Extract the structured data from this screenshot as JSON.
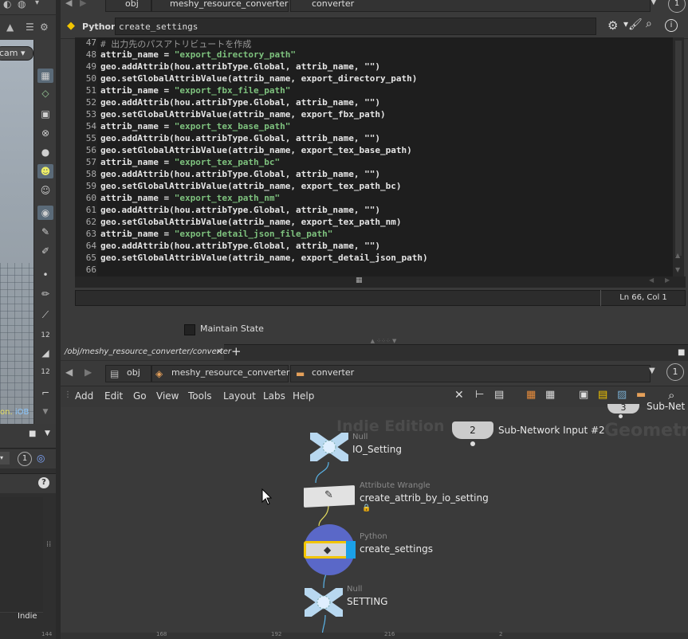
{
  "node": {
    "type_label": "Python",
    "name": "create_settings"
  },
  "editor": {
    "lines": [
      {
        "n": "47",
        "comment": "# 出力先のパスアトリビュートを作成"
      },
      {
        "n": "48",
        "pre": "attrib_name = ",
        "str": "\"export_directory_path\"",
        "post": ""
      },
      {
        "n": "49",
        "pre": "geo.addAttrib(hou.attribType.Global, attrib_name, \"\")",
        "str": "",
        "post": ""
      },
      {
        "n": "50",
        "pre": "geo.setGlobalAttribValue(attrib_name, export_directory_path)",
        "str": "",
        "post": ""
      },
      {
        "n": "51",
        "pre": "attrib_name = ",
        "str": "\"export_fbx_file_path\"",
        "post": ""
      },
      {
        "n": "52",
        "pre": "geo.addAttrib(hou.attribType.Global, attrib_name, \"\")",
        "str": "",
        "post": ""
      },
      {
        "n": "53",
        "pre": "geo.setGlobalAttribValue(attrib_name, export_fbx_path)",
        "str": "",
        "post": ""
      },
      {
        "n": "54",
        "pre": "attrib_name = ",
        "str": "\"export_tex_base_path\"",
        "post": ""
      },
      {
        "n": "55",
        "pre": "geo.addAttrib(hou.attribType.Global, attrib_name, \"\")",
        "str": "",
        "post": ""
      },
      {
        "n": "56",
        "pre": "geo.setGlobalAttribValue(attrib_name, export_tex_base_path)",
        "str": "",
        "post": ""
      },
      {
        "n": "57",
        "pre": "attrib_name = ",
        "str": "\"export_tex_path_bc\"",
        "post": ""
      },
      {
        "n": "58",
        "pre": "geo.addAttrib(hou.attribType.Global, attrib_name, \"\")",
        "str": "",
        "post": ""
      },
      {
        "n": "59",
        "pre": "geo.setGlobalAttribValue(attrib_name, export_tex_path_bc)",
        "str": "",
        "post": ""
      },
      {
        "n": "60",
        "pre": "attrib_name = ",
        "str": "\"export_tex_path_nm\"",
        "post": ""
      },
      {
        "n": "61",
        "pre": "geo.addAttrib(hou.attribType.Global, attrib_name, \"\")",
        "str": "",
        "post": ""
      },
      {
        "n": "62",
        "pre": "geo.setGlobalAttribValue(attrib_name, export_tex_path_nm)",
        "str": "",
        "post": ""
      },
      {
        "n": "63",
        "pre": "attrib_name = ",
        "str": "\"export_detail_json_file_path\"",
        "post": ""
      },
      {
        "n": "64",
        "pre": "geo.addAttrib(hou.attribType.Global, attrib_name, \"\")",
        "str": "",
        "post": ""
      },
      {
        "n": "65",
        "pre": "geo.setGlobalAttribValue(attrib_name, export_detail_json_path)",
        "str": "",
        "post": ""
      },
      {
        "n": "66",
        "pre": "",
        "str": "",
        "post": ""
      }
    ],
    "cursor_pos": "Ln 66, Col 1"
  },
  "maintain_state": "Maintain State",
  "viewport": {
    "cam_label": "cam",
    "footer_text": "on. ",
    "footer_link": "iOB"
  },
  "left_panel": {
    "indie_label": "Indie",
    "help_icon": "?"
  },
  "breadcrumbs_top": {
    "obj": "obj",
    "network": "meshy_resource_converter",
    "sop": "converter"
  },
  "network": {
    "tab_label": "/obj/meshy_resource_converter/converter",
    "tab_close": "×",
    "add_tab": "+",
    "path_obj": "obj",
    "path_network": "meshy_resource_converter",
    "path_sop": "converter",
    "viewer_count": "1",
    "menu": [
      "Add",
      "Edit",
      "Go",
      "View",
      "Tools",
      "Layout",
      "Labs",
      "Help"
    ],
    "watermark_edition": "Indie Edition",
    "watermark_context": "Geometry",
    "subnet_input_2_number": "2",
    "subnet_input_2_label": "Sub-Network Input #2",
    "subnet_input_3_number": "3",
    "subnet_input_3_label": "Sub-Net",
    "nodes": [
      {
        "type": "Null",
        "name": "IO_Setting"
      },
      {
        "type": "Attribute Wrangle",
        "name": "create_attrib_by_io_setting"
      },
      {
        "type": "Python",
        "name": "create_settings"
      },
      {
        "type": "Null",
        "name": "SETTING"
      }
    ],
    "ruler": [
      "144",
      "168",
      "192",
      "216",
      "2"
    ]
  },
  "colors": {
    "string": "#7ec27e",
    "selected_outline": "#f2c500",
    "python_node_ring": "#6c7bd8"
  }
}
